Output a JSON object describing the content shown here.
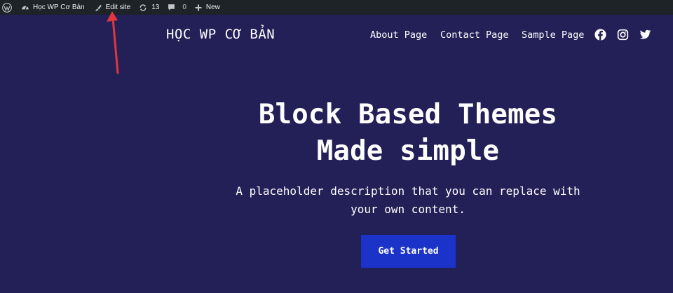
{
  "adminbar": {
    "site_name": "Học WP Cơ Bản",
    "edit_site": "Edit site",
    "updates_count": "13",
    "comments_count": "0",
    "new_label": "New"
  },
  "header": {
    "site_title": "HỌC WP CƠ BẢN",
    "nav": [
      "About Page",
      "Contact Page",
      "Sample Page"
    ],
    "social_icons": [
      "facebook-icon",
      "instagram-icon",
      "twitter-icon"
    ]
  },
  "hero": {
    "title_line1": "Block Based Themes",
    "title_line2": "Made simple",
    "desc_line1": "A placeholder description that you can replace with",
    "desc_line2": "your own content.",
    "cta_label": "Get Started"
  },
  "colors": {
    "background": "#232057",
    "adminbar": "#1d2327",
    "button": "#1b33c9",
    "arrow": "#e0363e"
  }
}
